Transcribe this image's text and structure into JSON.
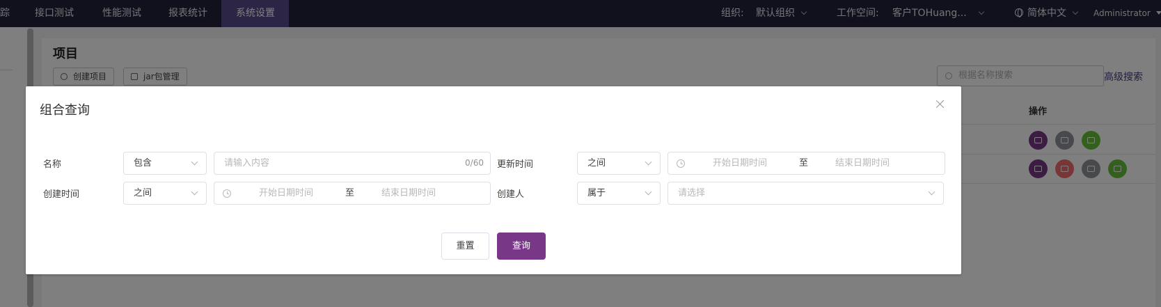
{
  "topnav": {
    "tabs": [
      {
        "label": "踪"
      },
      {
        "label": "接口测试"
      },
      {
        "label": "性能测试"
      },
      {
        "label": "报表统计"
      },
      {
        "label": "系统设置"
      }
    ],
    "org_label": "组织:",
    "org_value": "默认组织",
    "workspace_label": "工作空间:",
    "workspace_value": "客户TOHuang...",
    "language": "简体中文",
    "user": "Administrator"
  },
  "page": {
    "title": "项目",
    "create_button": "创建项目",
    "jar_button": "jar包管理",
    "search_placeholder": "根据名称搜索",
    "advanced_search": "高级搜索",
    "operations_header": "操作"
  },
  "dialog": {
    "title": "组合查询",
    "fields": {
      "name": {
        "label": "名称",
        "operator": "包含",
        "placeholder": "请输入内容",
        "counter": "0/60"
      },
      "update_time": {
        "label": "更新时间",
        "operator": "之间",
        "start_placeholder": "开始日期时间",
        "separator": "至",
        "end_placeholder": "结束日期时间"
      },
      "create_time": {
        "label": "创建时间",
        "operator": "之间",
        "start_placeholder": "开始日期时间",
        "separator": "至",
        "end_placeholder": "结束日期时间"
      },
      "creator": {
        "label": "创建人",
        "operator": "属于",
        "placeholder": "请选择"
      }
    },
    "reset_button": "重置",
    "query_button": "查询"
  },
  "colors": {
    "nav_bg": "#22203a",
    "nav_active": "#5b4a8a",
    "primary": "#783887",
    "danger": "#f56c6c",
    "success": "#67c23a",
    "info": "#909399"
  }
}
